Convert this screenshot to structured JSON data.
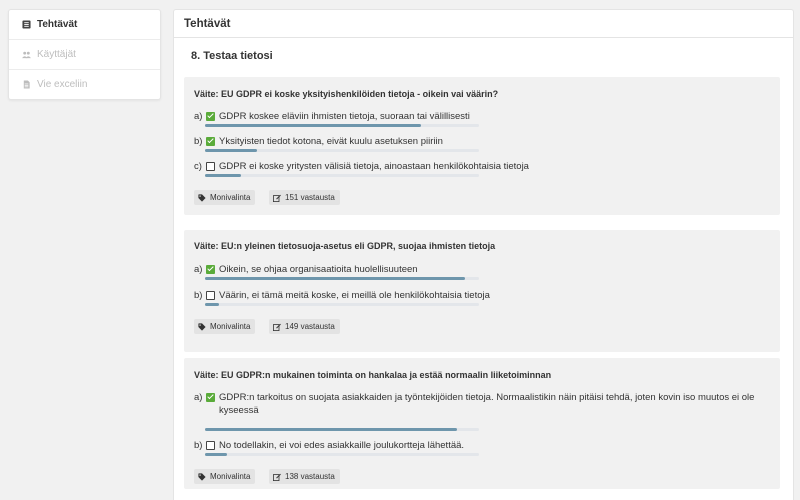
{
  "sidebar": {
    "items": [
      {
        "label": "Tehtävät",
        "icon": "list-icon",
        "active": true
      },
      {
        "label": "Käyttäjät",
        "icon": "users-icon",
        "active": false
      },
      {
        "label": "Vie exceliin",
        "icon": "file-icon",
        "active": false
      }
    ]
  },
  "main": {
    "header": "Tehtävät",
    "section_title": "8. Testaa tietosi"
  },
  "questions": [
    {
      "text": "Väite: EU GDPR ei koske yksityishenkilöiden tietoja - oikein vai väärin?",
      "answers": [
        {
          "letter": "a)",
          "text": "GDPR koskee eläviin ihmisten tietoja, suoraan tai välillisesti",
          "checked": true,
          "share": 0.79
        },
        {
          "letter": "b)",
          "text": "Yksityisten tiedot kotona, eivät kuulu asetuksen piiriin",
          "checked": true,
          "share": 0.19
        },
        {
          "letter": "c)",
          "text": "GDPR ei koske yritysten välisiä tietoja, ainoastaan henkilökohtaisia tietoja",
          "checked": false,
          "share": 0.13
        }
      ],
      "type_label": "Monivalinta",
      "responses": "151 vastausta"
    },
    {
      "text": "Väite: EU:n yleinen tietosuoja-asetus eli GDPR, suojaa ihmisten tietoja",
      "answers": [
        {
          "letter": "a)",
          "text": "Oikein, se ohjaa organisaatioita huolellisuuteen",
          "checked": true,
          "share": 0.95
        },
        {
          "letter": "b)",
          "text": "Väärin, ei tämä meitä koske, ei meillä ole henkilökohtaisia tietoja",
          "checked": false,
          "share": 0.05
        }
      ],
      "type_label": "Monivalinta",
      "responses": "149 vastausta"
    },
    {
      "text": "Väite: EU GDPR:n mukainen toiminta on hankalaa ja estää normaalin liiketoiminnan",
      "answers": [
        {
          "letter": "a)",
          "text": "GDPR:n tarkoitus on suojata asiakkaiden ja työntekijöiden tietoja. Normaalistikin näin pitäisi tehdä, joten kovin iso muutos ei ole kyseessä",
          "checked": true,
          "share": 0.92
        },
        {
          "letter": "b)",
          "text": "No todellakin, ei voi edes asiakkaille joulukortteja lähettää.",
          "checked": false,
          "share": 0.08
        }
      ],
      "type_label": "Monivalinta",
      "responses": "138 vastausta"
    }
  ],
  "colors": {
    "check_green": "#5aab3a",
    "bar_fill": "#6e96ac",
    "bar_track": "#e3e6ea",
    "card_bg": "#f1f1f1"
  }
}
